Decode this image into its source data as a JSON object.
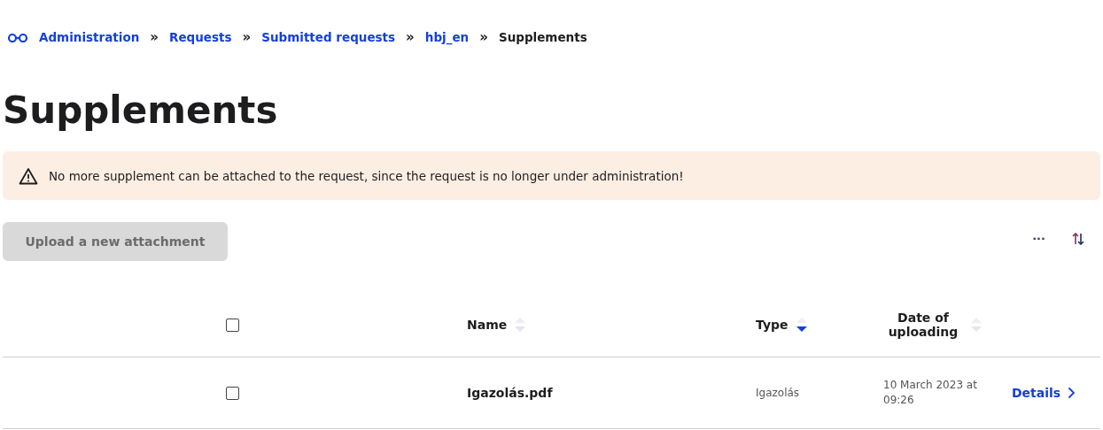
{
  "breadcrumb": [
    {
      "label": "Administration",
      "current": false
    },
    {
      "label": "Requests",
      "current": false
    },
    {
      "label": "Submitted requests",
      "current": false
    },
    {
      "label": "hbj_en",
      "current": false
    },
    {
      "label": "Supplements",
      "current": true
    }
  ],
  "breadcrumb_separator": "»",
  "title": "Supplements",
  "alert": {
    "text": "No more supplement can be attached to the request, since the request is no longer under administration!"
  },
  "upload_button": {
    "label": "Upload a new attachment",
    "disabled": true
  },
  "toolbar": {
    "more": "···"
  },
  "table": {
    "select_all": {
      "checked": false
    },
    "columns": [
      {
        "label": "Name",
        "sorted": false
      },
      {
        "label": "Type",
        "sorted": true
      },
      {
        "label": "Date of uploading",
        "sorted": false
      }
    ],
    "rows": [
      {
        "checked": false,
        "name": "Igazolás.pdf",
        "type": "Igazolás",
        "date": "10 March 2023 at 09:26",
        "action": "Details"
      }
    ]
  }
}
